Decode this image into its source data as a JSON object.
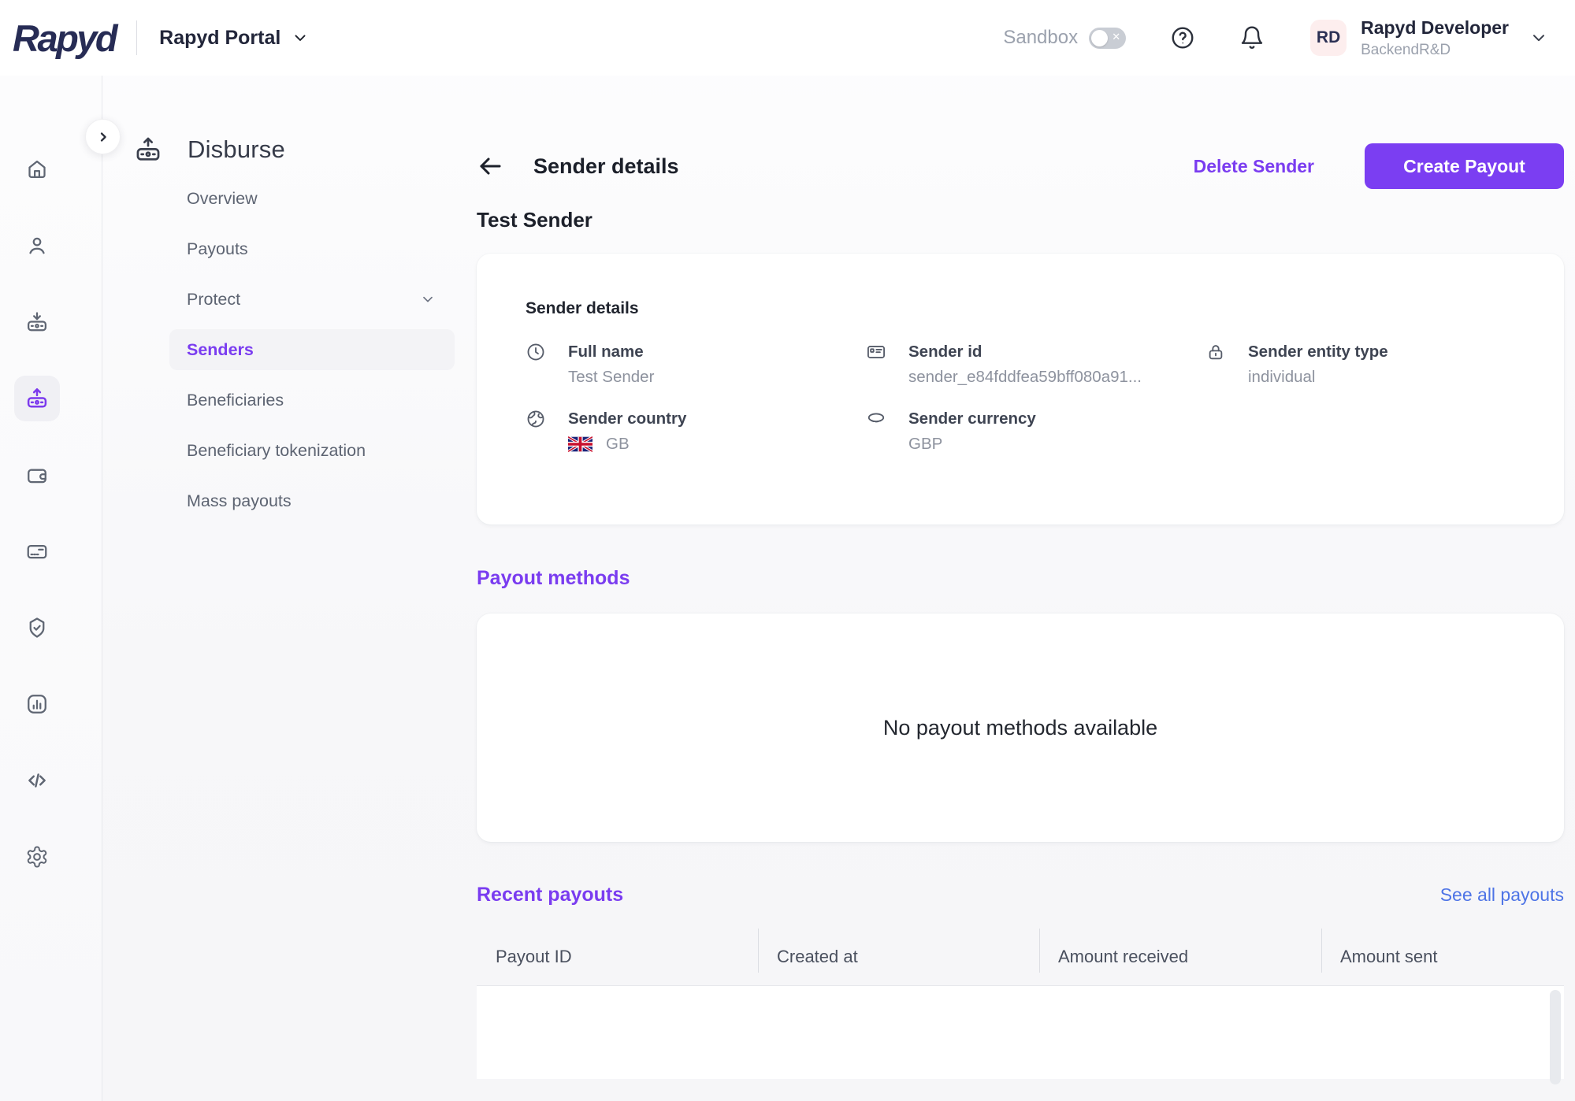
{
  "header": {
    "logo": "Rapyd",
    "portal_label": "Rapyd Portal",
    "sandbox_label": "Sandbox",
    "sandbox_enabled": false,
    "user": {
      "initials": "RD",
      "name": "Rapyd Developer",
      "org": "BackendR&D"
    }
  },
  "rail": {
    "items": [
      {
        "icon": "home"
      },
      {
        "icon": "user"
      },
      {
        "icon": "collect"
      },
      {
        "icon": "disburse",
        "active": true
      },
      {
        "icon": "wallet"
      },
      {
        "icon": "card"
      },
      {
        "icon": "shield-check"
      },
      {
        "icon": "analytics"
      },
      {
        "icon": "code"
      },
      {
        "icon": "settings"
      }
    ]
  },
  "sidebar": {
    "title": "Disburse",
    "items": [
      {
        "label": "Overview"
      },
      {
        "label": "Payouts"
      },
      {
        "label": "Protect",
        "has_chevron": true
      },
      {
        "label": "Senders",
        "active": true
      },
      {
        "label": "Beneficiaries"
      },
      {
        "label": "Beneficiary tokenization"
      },
      {
        "label": "Mass payouts"
      }
    ]
  },
  "page": {
    "title": "Sender details",
    "delete_label": "Delete Sender",
    "create_label": "Create Payout",
    "sender_name": "Test Sender"
  },
  "details_card": {
    "title": "Sender details",
    "fields": [
      {
        "icon": "clock",
        "label": "Full name",
        "value": "Test Sender"
      },
      {
        "icon": "id-card",
        "label": "Sender id",
        "value": "sender_e84fddfea59bff080a91..."
      },
      {
        "icon": "lock",
        "label": "Sender entity type",
        "value": "individual"
      },
      {
        "icon": "globe",
        "label": "Sender country",
        "value": "GB",
        "flag": "gb"
      },
      {
        "icon": "coin",
        "label": "Sender currency",
        "value": "GBP"
      }
    ]
  },
  "payout_methods": {
    "title": "Payout methods",
    "empty_text": "No payout methods available"
  },
  "recent_payouts": {
    "title": "Recent payouts",
    "see_all_label": "See all payouts",
    "columns": [
      "Payout ID",
      "Created at",
      "Amount received",
      "Amount sent"
    ]
  },
  "colors": {
    "accent_purple": "#7b3ef2",
    "link_blue": "#4e74e6",
    "brand_navy": "#272c55",
    "text_dark": "#1c202a",
    "text_gray": "#8d929e",
    "icon_gray": "#5f6673",
    "avatar_bg": "#fdeeee"
  }
}
